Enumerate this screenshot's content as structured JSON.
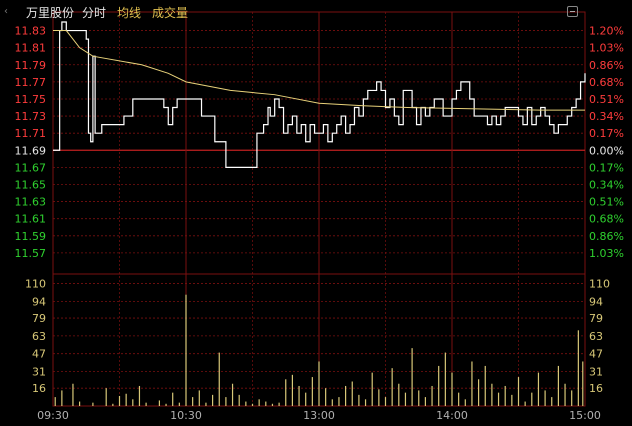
{
  "header": {
    "stock_name": "万里股份",
    "mode": "分时",
    "avg_label": "均线",
    "vol_label": "成交量"
  },
  "colors": {
    "background": "#000000",
    "grid": "#7a1010",
    "up": "#ff3c3c",
    "down": "#2fd12f",
    "neutral": "#e6e6e6",
    "price_line": "#ffffff",
    "avg_line": "#e8d27a",
    "volume": "#d8c878"
  },
  "chart_data": {
    "type": "line",
    "prev_close": 11.69,
    "price_axis": {
      "ylim": [
        11.55,
        11.84
      ],
      "ticks": [
        "11.83",
        "11.81",
        "11.79",
        "11.77",
        "11.75",
        "11.73",
        "11.71",
        "11.69",
        "11.67",
        "11.65",
        "11.63",
        "11.61",
        "11.59",
        "11.57"
      ],
      "pct_ticks": [
        "1.20%",
        "1.03%",
        "0.86%",
        "0.68%",
        "0.51%",
        "0.34%",
        "0.17%",
        "0.00%",
        "0.17%",
        "0.34%",
        "0.51%",
        "0.68%",
        "0.86%",
        "1.03%"
      ]
    },
    "volume_axis": {
      "ylim": [
        0,
        115
      ],
      "ticks": [
        "110",
        "94",
        "79",
        "63",
        "47",
        "31",
        "16"
      ]
    },
    "time_labels": [
      "09:30",
      "10:30",
      "13:00",
      "14:00",
      "15:00"
    ],
    "total_minutes": 240,
    "series": [
      {
        "key": "price",
        "points": [
          [
            0,
            11.69
          ],
          [
            2,
            11.69
          ],
          [
            3,
            11.83
          ],
          [
            4,
            11.84
          ],
          [
            6,
            11.83
          ],
          [
            14,
            11.83
          ],
          [
            15,
            11.82
          ],
          [
            16,
            11.71
          ],
          [
            17,
            11.7
          ],
          [
            18,
            11.8
          ],
          [
            19,
            11.71
          ],
          [
            22,
            11.72
          ],
          [
            30,
            11.72
          ],
          [
            32,
            11.73
          ],
          [
            36,
            11.75
          ],
          [
            48,
            11.75
          ],
          [
            50,
            11.74
          ],
          [
            52,
            11.72
          ],
          [
            54,
            11.74
          ],
          [
            56,
            11.75
          ],
          [
            66,
            11.75
          ],
          [
            67,
            11.73
          ],
          [
            72,
            11.73
          ],
          [
            73,
            11.7
          ],
          [
            76,
            11.7
          ],
          [
            78,
            11.67
          ],
          [
            90,
            11.67
          ],
          [
            92,
            11.71
          ],
          [
            95,
            11.72
          ],
          [
            97,
            11.74
          ],
          [
            98,
            11.73
          ],
          [
            100,
            11.75
          ],
          [
            102,
            11.74
          ],
          [
            104,
            11.71
          ],
          [
            106,
            11.72
          ],
          [
            108,
            11.73
          ],
          [
            110,
            11.71
          ],
          [
            112,
            11.72
          ],
          [
            114,
            11.7
          ],
          [
            116,
            11.72
          ],
          [
            118,
            11.71
          ],
          [
            120,
            11.71
          ],
          [
            122,
            11.72
          ],
          [
            124,
            11.7
          ],
          [
            126,
            11.71
          ],
          [
            128,
            11.72
          ],
          [
            130,
            11.73
          ],
          [
            132,
            11.71
          ],
          [
            134,
            11.72
          ],
          [
            136,
            11.74
          ],
          [
            138,
            11.73
          ],
          [
            140,
            11.75
          ],
          [
            142,
            11.76
          ],
          [
            144,
            11.76
          ],
          [
            146,
            11.77
          ],
          [
            148,
            11.76
          ],
          [
            150,
            11.74
          ],
          [
            152,
            11.75
          ],
          [
            154,
            11.73
          ],
          [
            156,
            11.72
          ],
          [
            158,
            11.76
          ],
          [
            160,
            11.76
          ],
          [
            162,
            11.74
          ],
          [
            164,
            11.72
          ],
          [
            166,
            11.74
          ],
          [
            168,
            11.73
          ],
          [
            170,
            11.74
          ],
          [
            172,
            11.75
          ],
          [
            176,
            11.73
          ],
          [
            180,
            11.75
          ],
          [
            182,
            11.76
          ],
          [
            184,
            11.77
          ],
          [
            186,
            11.77
          ],
          [
            188,
            11.75
          ],
          [
            190,
            11.73
          ],
          [
            194,
            11.73
          ],
          [
            196,
            11.72
          ],
          [
            198,
            11.73
          ],
          [
            200,
            11.72
          ],
          [
            202,
            11.73
          ],
          [
            204,
            11.74
          ],
          [
            208,
            11.74
          ],
          [
            210,
            11.73
          ],
          [
            212,
            11.72
          ],
          [
            214,
            11.74
          ],
          [
            216,
            11.72
          ],
          [
            218,
            11.73
          ],
          [
            220,
            11.74
          ],
          [
            222,
            11.73
          ],
          [
            224,
            11.72
          ],
          [
            226,
            11.71
          ],
          [
            228,
            11.72
          ],
          [
            230,
            11.72
          ],
          [
            232,
            11.73
          ],
          [
            234,
            11.74
          ],
          [
            236,
            11.75
          ],
          [
            238,
            11.77
          ],
          [
            240,
            11.78
          ]
        ]
      },
      {
        "key": "average",
        "points": [
          [
            0,
            11.83
          ],
          [
            6,
            11.83
          ],
          [
            12,
            11.81
          ],
          [
            18,
            11.8
          ],
          [
            40,
            11.79
          ],
          [
            52,
            11.78
          ],
          [
            60,
            11.77
          ],
          [
            80,
            11.76
          ],
          [
            100,
            11.755
          ],
          [
            120,
            11.745
          ],
          [
            140,
            11.742
          ],
          [
            160,
            11.74
          ],
          [
            180,
            11.739
          ],
          [
            200,
            11.738
          ],
          [
            220,
            11.737
          ],
          [
            240,
            11.737
          ]
        ]
      }
    ],
    "volume": [
      [
        1,
        8
      ],
      [
        4,
        14
      ],
      [
        9,
        20
      ],
      [
        12,
        4
      ],
      [
        18,
        3
      ],
      [
        24,
        16
      ],
      [
        27,
        2
      ],
      [
        30,
        9
      ],
      [
        33,
        11
      ],
      [
        36,
        6
      ],
      [
        39,
        18
      ],
      [
        42,
        3
      ],
      [
        48,
        5
      ],
      [
        51,
        2
      ],
      [
        54,
        12
      ],
      [
        57,
        3
      ],
      [
        60,
        100
      ],
      [
        63,
        8
      ],
      [
        66,
        14
      ],
      [
        69,
        3
      ],
      [
        72,
        10
      ],
      [
        75,
        48
      ],
      [
        78,
        8
      ],
      [
        81,
        20
      ],
      [
        84,
        10
      ],
      [
        87,
        4
      ],
      [
        90,
        2
      ],
      [
        93,
        6
      ],
      [
        96,
        4
      ],
      [
        99,
        2
      ],
      [
        102,
        3
      ],
      [
        105,
        24
      ],
      [
        108,
        28
      ],
      [
        111,
        18
      ],
      [
        114,
        12
      ],
      [
        117,
        26
      ],
      [
        120,
        40
      ],
      [
        123,
        16
      ],
      [
        126,
        6
      ],
      [
        129,
        8
      ],
      [
        132,
        18
      ],
      [
        135,
        22
      ],
      [
        138,
        10
      ],
      [
        141,
        6
      ],
      [
        144,
        30
      ],
      [
        147,
        15
      ],
      [
        150,
        8
      ],
      [
        153,
        34
      ],
      [
        156,
        20
      ],
      [
        159,
        12
      ],
      [
        162,
        52
      ],
      [
        165,
        14
      ],
      [
        168,
        8
      ],
      [
        171,
        18
      ],
      [
        174,
        36
      ],
      [
        177,
        48
      ],
      [
        180,
        30
      ],
      [
        183,
        12
      ],
      [
        186,
        6
      ],
      [
        189,
        40
      ],
      [
        192,
        24
      ],
      [
        195,
        36
      ],
      [
        198,
        20
      ],
      [
        201,
        12
      ],
      [
        204,
        18
      ],
      [
        207,
        10
      ],
      [
        210,
        26
      ],
      [
        213,
        4
      ],
      [
        216,
        12
      ],
      [
        219,
        30
      ],
      [
        222,
        14
      ],
      [
        225,
        8
      ],
      [
        228,
        36
      ],
      [
        231,
        20
      ],
      [
        234,
        14
      ],
      [
        237,
        68
      ],
      [
        239,
        40
      ]
    ]
  }
}
